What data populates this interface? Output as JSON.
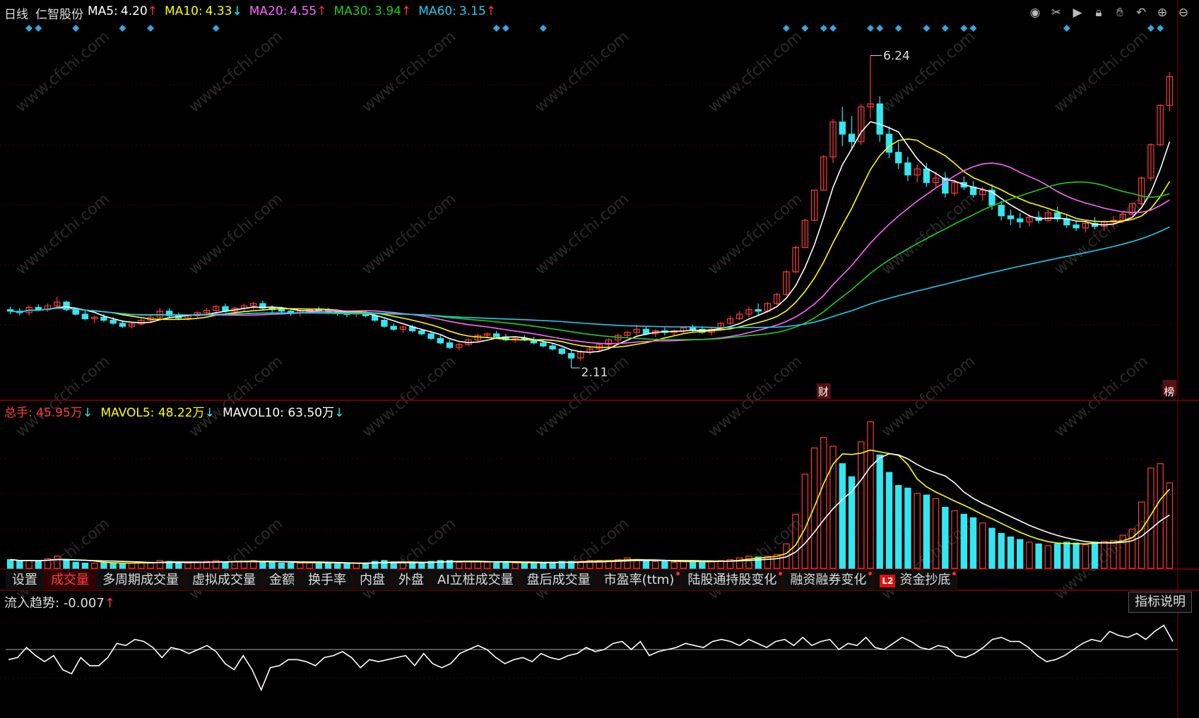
{
  "legend": {
    "period": "日线",
    "stock": "仁智股份",
    "items": [
      {
        "label": "MA5:",
        "value": "4.20",
        "arrow": "↑",
        "color": "#ffffff",
        "arrowColor": "#ff3030"
      },
      {
        "label": "MA10:",
        "value": "4.33",
        "arrow": "↓",
        "color": "#ffff00",
        "arrowColor": "#00ffff"
      },
      {
        "label": "MA20:",
        "value": "4.55",
        "arrow": "↑",
        "color": "#ff66ff",
        "arrowColor": "#ff3030"
      },
      {
        "label": "MA30:",
        "value": "3.94",
        "arrow": "↑",
        "color": "#22cc22",
        "arrowColor": "#ff3030"
      },
      {
        "label": "MA60:",
        "value": "3.15",
        "arrow": "↑",
        "color": "#22ccee",
        "arrowColor": "#ff3030"
      }
    ]
  },
  "toolbar": {
    "icons": [
      {
        "name": "eye-icon",
        "glyph": "◉"
      },
      {
        "name": "scissors-icon",
        "glyph": "✂"
      },
      {
        "name": "play-icon",
        "glyph": "▶"
      },
      {
        "name": "lock-icon",
        "glyph": "🔒︎"
      },
      {
        "name": "hand-icon",
        "glyph": "✋︎"
      },
      {
        "name": "undo-icon",
        "glyph": "↶"
      },
      {
        "name": "zoom-in-icon",
        "glyph": "⊕"
      },
      {
        "name": "zoom-out-icon",
        "glyph": "⊖"
      }
    ]
  },
  "annotations": {
    "high": "6.24",
    "low": "2.11",
    "badge_finance": "财",
    "badge_rank": "榜"
  },
  "volume_legend": {
    "total_label": "总手:",
    "total_value": "45.95万",
    "total_arrow": "↓",
    "mavol5_label": "MAVOL5:",
    "mavol5_value": "48.22万",
    "mavol5_arrow": "↓",
    "mavol10_label": "MAVOL10:",
    "mavol10_value": "63.50万",
    "mavol10_arrow": "↓"
  },
  "tabs": [
    {
      "label": "设置",
      "active": false,
      "dot": false
    },
    {
      "label": "成交量",
      "active": true,
      "dot": false
    },
    {
      "label": "多周期成交量",
      "active": false,
      "dot": false
    },
    {
      "label": "虚拟成交量",
      "active": false,
      "dot": false
    },
    {
      "label": "金额",
      "active": false,
      "dot": false
    },
    {
      "label": "换手率",
      "active": false,
      "dot": false
    },
    {
      "label": "内盘",
      "active": false,
      "dot": false
    },
    {
      "label": "外盘",
      "active": false,
      "dot": false
    },
    {
      "label": "AI立桩成交量",
      "active": false,
      "dot": false
    },
    {
      "label": "盘后成交量",
      "active": false,
      "dot": false
    },
    {
      "label": "市盈率(ttm)",
      "active": false,
      "dot": true
    },
    {
      "label": "陆股通持股变化",
      "active": false,
      "dot": true
    },
    {
      "label": "融资融券变化",
      "active": false,
      "dot": true
    },
    {
      "label": "资金抄底",
      "active": false,
      "dot": true,
      "badge": "L2"
    }
  ],
  "flow_legend": {
    "label": "流入趋势:",
    "value": "-0.007",
    "arrow": "↑"
  },
  "explain_button": "指标说明",
  "watermark": "www.cfchi.com",
  "colors": {
    "up": "#ff3b3b",
    "down": "#33e6f0",
    "ma5": "#ffffff",
    "ma10": "#ffff00",
    "ma20": "#ff66ff",
    "ma30": "#22cc22",
    "ma60": "#22ccee",
    "signal": "#33a6e0"
  },
  "chart_data": [
    {
      "type": "candlestick",
      "title": "",
      "ylim": [
        1.7,
        6.6
      ],
      "grid": true,
      "candles_ohlc": [
        [
          2.88,
          2.92,
          2.82,
          2.86
        ],
        [
          2.86,
          2.9,
          2.8,
          2.84
        ],
        [
          2.84,
          2.93,
          2.8,
          2.91
        ],
        [
          2.91,
          2.95,
          2.86,
          2.88
        ],
        [
          2.88,
          2.96,
          2.85,
          2.93
        ],
        [
          2.93,
          3.05,
          2.9,
          2.98
        ],
        [
          2.98,
          3.0,
          2.86,
          2.88
        ],
        [
          2.88,
          2.91,
          2.8,
          2.82
        ],
        [
          2.82,
          2.86,
          2.74,
          2.76
        ],
        [
          2.76,
          2.8,
          2.7,
          2.78
        ],
        [
          2.78,
          2.82,
          2.72,
          2.74
        ],
        [
          2.74,
          2.78,
          2.68,
          2.7
        ],
        [
          2.7,
          2.74,
          2.64,
          2.66
        ],
        [
          2.66,
          2.71,
          2.63,
          2.69
        ],
        [
          2.69,
          2.76,
          2.67,
          2.74
        ],
        [
          2.74,
          2.8,
          2.71,
          2.78
        ],
        [
          2.78,
          2.9,
          2.76,
          2.86
        ],
        [
          2.86,
          2.9,
          2.78,
          2.8
        ],
        [
          2.8,
          2.84,
          2.74,
          2.77
        ],
        [
          2.77,
          2.82,
          2.74,
          2.8
        ],
        [
          2.8,
          2.86,
          2.76,
          2.84
        ],
        [
          2.84,
          2.9,
          2.8,
          2.87
        ],
        [
          2.87,
          2.94,
          2.84,
          2.92
        ],
        [
          2.92,
          2.96,
          2.84,
          2.86
        ],
        [
          2.86,
          2.92,
          2.82,
          2.9
        ],
        [
          2.9,
          2.96,
          2.86,
          2.93
        ],
        [
          2.93,
          2.98,
          2.88,
          2.96
        ],
        [
          2.96,
          3.0,
          2.88,
          2.9
        ],
        [
          2.9,
          2.94,
          2.84,
          2.88
        ],
        [
          2.88,
          2.92,
          2.82,
          2.86
        ],
        [
          2.86,
          2.9,
          2.8,
          2.84
        ],
        [
          2.84,
          2.88,
          2.79,
          2.86
        ],
        [
          2.86,
          2.9,
          2.82,
          2.88
        ],
        [
          2.88,
          2.92,
          2.84,
          2.87
        ],
        [
          2.87,
          2.9,
          2.82,
          2.85
        ],
        [
          2.85,
          2.88,
          2.8,
          2.83
        ],
        [
          2.83,
          2.86,
          2.78,
          2.82
        ],
        [
          2.82,
          2.86,
          2.78,
          2.84
        ],
        [
          2.84,
          2.86,
          2.78,
          2.8
        ],
        [
          2.8,
          2.82,
          2.72,
          2.74
        ],
        [
          2.74,
          2.76,
          2.64,
          2.66
        ],
        [
          2.66,
          2.7,
          2.6,
          2.62
        ],
        [
          2.62,
          2.67,
          2.58,
          2.65
        ],
        [
          2.65,
          2.68,
          2.58,
          2.6
        ],
        [
          2.6,
          2.63,
          2.54,
          2.56
        ],
        [
          2.56,
          2.6,
          2.48,
          2.5
        ],
        [
          2.5,
          2.54,
          2.42,
          2.44
        ],
        [
          2.44,
          2.48,
          2.36,
          2.38
        ],
        [
          2.38,
          2.44,
          2.34,
          2.42
        ],
        [
          2.42,
          2.5,
          2.4,
          2.48
        ],
        [
          2.48,
          2.56,
          2.46,
          2.54
        ],
        [
          2.54,
          2.58,
          2.5,
          2.56
        ],
        [
          2.56,
          2.6,
          2.5,
          2.52
        ],
        [
          2.52,
          2.56,
          2.46,
          2.48
        ],
        [
          2.48,
          2.53,
          2.44,
          2.5
        ],
        [
          2.5,
          2.54,
          2.46,
          2.48
        ],
        [
          2.48,
          2.52,
          2.42,
          2.44
        ],
        [
          2.44,
          2.48,
          2.38,
          2.4
        ],
        [
          2.4,
          2.44,
          2.34,
          2.36
        ],
        [
          2.36,
          2.38,
          2.28,
          2.3
        ],
        [
          2.3,
          2.34,
          2.11,
          2.24
        ],
        [
          2.24,
          2.34,
          2.2,
          2.32
        ],
        [
          2.32,
          2.4,
          2.28,
          2.36
        ],
        [
          2.36,
          2.44,
          2.32,
          2.42
        ],
        [
          2.42,
          2.5,
          2.38,
          2.48
        ],
        [
          2.48,
          2.56,
          2.44,
          2.54
        ],
        [
          2.54,
          2.6,
          2.5,
          2.58
        ],
        [
          2.58,
          2.68,
          2.54,
          2.62
        ],
        [
          2.62,
          2.66,
          2.54,
          2.56
        ],
        [
          2.56,
          2.62,
          2.52,
          2.6
        ],
        [
          2.6,
          2.64,
          2.54,
          2.58
        ],
        [
          2.58,
          2.62,
          2.54,
          2.6
        ],
        [
          2.6,
          2.66,
          2.56,
          2.64
        ],
        [
          2.64,
          2.68,
          2.58,
          2.62
        ],
        [
          2.62,
          2.66,
          2.56,
          2.58
        ],
        [
          2.58,
          2.64,
          2.54,
          2.62
        ],
        [
          2.62,
          2.72,
          2.6,
          2.7
        ],
        [
          2.7,
          2.8,
          2.68,
          2.76
        ],
        [
          2.76,
          2.86,
          2.74,
          2.82
        ],
        [
          2.82,
          2.92,
          2.78,
          2.88
        ],
        [
          2.88,
          2.96,
          2.8,
          2.86
        ],
        [
          2.86,
          2.98,
          2.84,
          2.96
        ],
        [
          2.96,
          3.1,
          2.94,
          3.08
        ],
        [
          3.08,
          3.4,
          3.06,
          3.38
        ],
        [
          3.38,
          3.72,
          3.36,
          3.7
        ],
        [
          3.7,
          4.08,
          3.7,
          4.06
        ],
        [
          4.06,
          4.46,
          4.06,
          4.46
        ],
        [
          4.46,
          4.92,
          4.46,
          4.9
        ],
        [
          4.9,
          5.4,
          4.82,
          5.36
        ],
        [
          5.36,
          5.56,
          5.04,
          5.2
        ],
        [
          5.2,
          5.44,
          5.0,
          5.1
        ],
        [
          5.1,
          5.6,
          5.06,
          5.56
        ],
        [
          5.56,
          6.24,
          5.4,
          5.6
        ],
        [
          5.6,
          5.7,
          5.1,
          5.2
        ],
        [
          5.2,
          5.3,
          4.88,
          4.96
        ],
        [
          4.96,
          5.1,
          4.74,
          4.82
        ],
        [
          4.82,
          4.9,
          4.58,
          4.66
        ],
        [
          4.66,
          4.8,
          4.56,
          4.74
        ],
        [
          4.74,
          4.82,
          4.5,
          4.56
        ],
        [
          4.56,
          4.7,
          4.48,
          4.62
        ],
        [
          4.62,
          4.7,
          4.36,
          4.42
        ],
        [
          4.42,
          4.6,
          4.38,
          4.56
        ],
        [
          4.56,
          4.64,
          4.46,
          4.5
        ],
        [
          4.5,
          4.58,
          4.36,
          4.4
        ],
        [
          4.4,
          4.5,
          4.32,
          4.46
        ],
        [
          4.46,
          4.54,
          4.2,
          4.26
        ],
        [
          4.26,
          4.32,
          4.06,
          4.12
        ],
        [
          4.12,
          4.2,
          4.0,
          4.08
        ],
        [
          4.08,
          4.16,
          3.96,
          4.04
        ],
        [
          4.04,
          4.14,
          3.98,
          4.1
        ],
        [
          4.1,
          4.18,
          4.02,
          4.06
        ],
        [
          4.06,
          4.2,
          4.04,
          4.16
        ],
        [
          4.16,
          4.24,
          4.04,
          4.08
        ],
        [
          4.08,
          4.14,
          3.96,
          4.0
        ],
        [
          4.0,
          4.06,
          3.92,
          3.96
        ],
        [
          3.96,
          4.04,
          3.9,
          4.02
        ],
        [
          4.02,
          4.1,
          3.94,
          3.98
        ],
        [
          3.98,
          4.06,
          3.92,
          4.04
        ],
        [
          4.04,
          4.12,
          3.98,
          4.06
        ],
        [
          4.06,
          4.18,
          4.02,
          4.14
        ],
        [
          4.14,
          4.3,
          4.12,
          4.28
        ],
        [
          4.28,
          4.64,
          4.26,
          4.62
        ],
        [
          4.62,
          5.08,
          4.58,
          5.06
        ],
        [
          5.06,
          5.6,
          5.04,
          5.58
        ],
        [
          5.58,
          6.02,
          5.5,
          5.96
        ]
      ]
    },
    {
      "type": "bar",
      "title": "",
      "ylim": [
        0,
        170
      ],
      "units": "万",
      "volumes": [
        10,
        8,
        9,
        8,
        11,
        14,
        9,
        7,
        6,
        6,
        7,
        6,
        5,
        6,
        7,
        7,
        9,
        8,
        6,
        6,
        7,
        8,
        9,
        7,
        8,
        8,
        9,
        8,
        7,
        6,
        6,
        6,
        7,
        7,
        6,
        5,
        5,
        6,
        6,
        8,
        9,
        7,
        6,
        6,
        7,
        8,
        9,
        9,
        7,
        8,
        8,
        7,
        6,
        7,
        6,
        6,
        7,
        6,
        7,
        8,
        8,
        8,
        9,
        9,
        9,
        10,
        12,
        10,
        8,
        8,
        8,
        7,
        8,
        8,
        7,
        8,
        9,
        10,
        12,
        14,
        13,
        14,
        16,
        28,
        62,
        108,
        138,
        150,
        140,
        120,
        105,
        145,
        168,
        130,
        110,
        95,
        92,
        86,
        84,
        80,
        70,
        66,
        62,
        58,
        52,
        46,
        40,
        36,
        33,
        30,
        28,
        26,
        28,
        30,
        29,
        27,
        30,
        31,
        32,
        38,
        45,
        76,
        115,
        120,
        98
      ],
      "mavol5": [
        47.0,
        48.22
      ],
      "mavol10": [
        63.5
      ]
    },
    {
      "type": "line",
      "title": "",
      "ylim": [
        -0.25,
        0.25
      ],
      "series": [
        {
          "name": "流入趋势",
          "values": [
            -0.05,
            -0.04,
            0.01,
            -0.03,
            -0.06,
            -0.03,
            -0.1,
            -0.12,
            -0.04,
            -0.08,
            -0.08,
            -0.04,
            0.03,
            0.02,
            0.05,
            0.04,
            0.01,
            -0.04,
            0.01,
            0.0,
            -0.02,
            0.0,
            0.02,
            -0.01,
            -0.07,
            -0.1,
            -0.03,
            -0.1,
            -0.2,
            -0.09,
            -0.08,
            -0.05,
            -0.05,
            -0.06,
            -0.08,
            -0.04,
            -0.03,
            -0.01,
            -0.04,
            -0.09,
            -0.05,
            -0.06,
            -0.05,
            -0.04,
            -0.03,
            -0.08,
            -0.02,
            -0.07,
            -0.09,
            -0.07,
            -0.02,
            0.0,
            0.02,
            0.0,
            -0.04,
            -0.07,
            -0.05,
            -0.04,
            -0.06,
            -0.02,
            -0.04,
            -0.05,
            -0.03,
            -0.02,
            0.01,
            -0.01,
            0.0,
            0.03,
            0.04,
            0.0,
            0.04,
            -0.03,
            -0.01,
            0.0,
            0.01,
            0.03,
            0.02,
            0.01,
            0.04,
            0.05,
            0.04,
            0.02,
            0.05,
            0.03,
            0.01,
            0.04,
            0.05,
            0.02,
            0.06,
            0.02,
            0.04,
            0.05,
            0.0,
            0.03,
            0.02,
            0.06,
            0.01,
            0.0,
            0.03,
            0.06,
            0.04,
            0.01,
            0.0,
            0.02,
            0.01,
            -0.03,
            -0.04,
            -0.02,
            0.01,
            0.05,
            0.06,
            0.04,
            0.04,
            0.01,
            -0.03,
            -0.06,
            -0.05,
            -0.03,
            0.0,
            0.03,
            0.05,
            0.04,
            0.09,
            0.07,
            0.06,
            0.08,
            0.05,
            0.09,
            0.12,
            0.04
          ]
        }
      ]
    }
  ]
}
